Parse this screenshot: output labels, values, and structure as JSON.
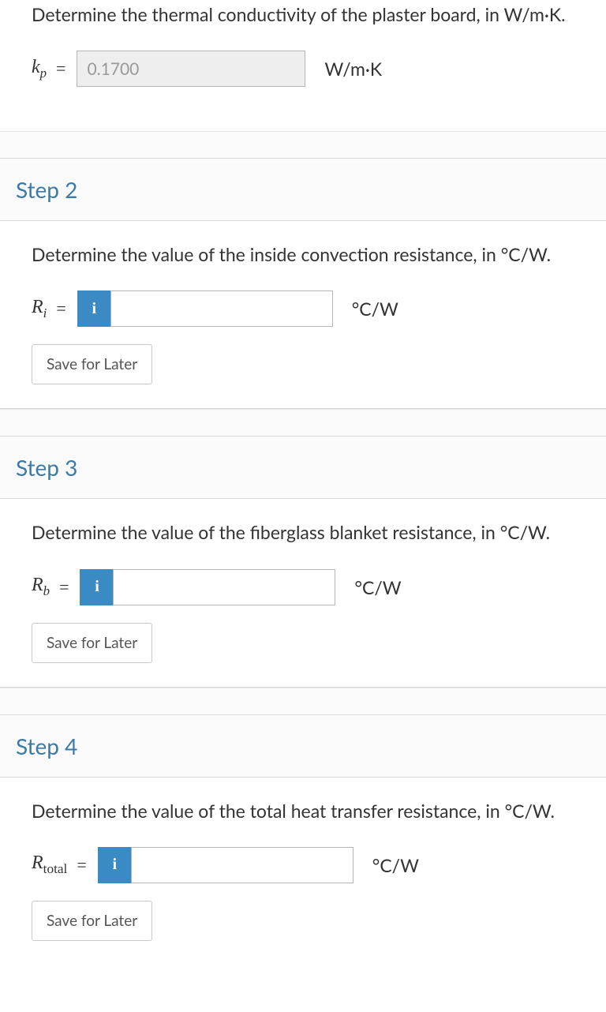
{
  "step1": {
    "prompt": "Determine the thermal conductivity of the plaster board, in W/m·K.",
    "var_html": "k<sub>p</sub>",
    "value": "0.1700",
    "unit": "W/m·K"
  },
  "step2": {
    "title": "Step 2",
    "prompt": "Determine the value of the inside convection resistance, in °C/W.",
    "var_html": "R<sub>i</sub>",
    "unit": "°C/W",
    "save_label": "Save for Later"
  },
  "step3": {
    "title": "Step 3",
    "prompt": "Determine the value of the fiberglass blanket resistance, in °C/W.",
    "var_html": "R<sub>b</sub>",
    "unit": "°C/W",
    "save_label": "Save for Later"
  },
  "step4": {
    "title": "Step 4",
    "prompt": "Determine the value of the total heat transfer resistance, in °C/W.",
    "var_html": "R<span class=\"sub-roman\">total</span>",
    "unit": "°C/W",
    "save_label": "Save for Later"
  },
  "icons": {
    "info": "i"
  }
}
